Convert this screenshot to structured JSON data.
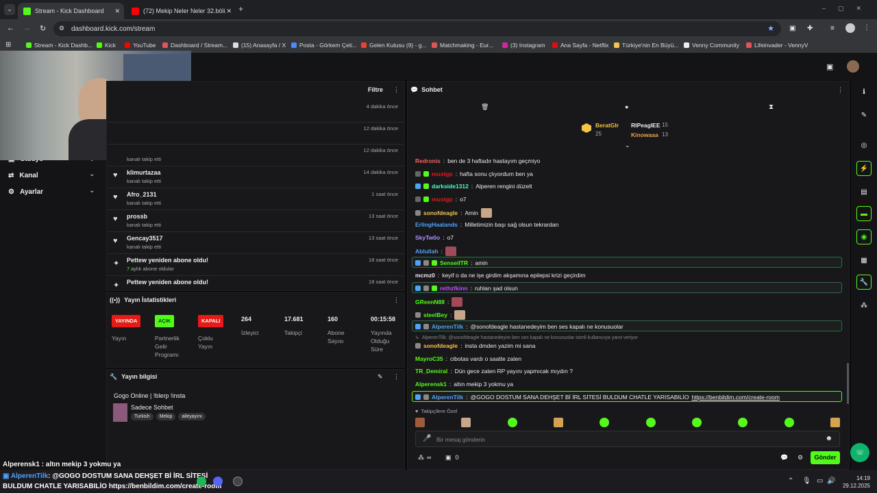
{
  "browser": {
    "tabs": [
      {
        "title": "Stream - Kick Dashboard",
        "favicon": "kick-icon"
      },
      {
        "title": "(72) Mekip Neler Neler 32.bölü",
        "favicon": "youtube-icon"
      }
    ],
    "url": "dashboard.kick.com/stream",
    "bookmarks": [
      "Stream - Kick Dashb...",
      "Kick",
      "YouTube",
      "Dashboard / Stream...",
      "(15) Anasayfa / X",
      "Posta - Görkem Çeti...",
      "Gelen Kutusu (9) - g...",
      "Matchmaking - Eur...",
      "(3) Instagram",
      "Ana Sayfa - Netflix",
      "Türkiye'nin En Büyü...",
      "Venny Community",
      "Lifeinvader - VennyV"
    ]
  },
  "sidebar": {
    "items": [
      {
        "label": "Stüdyo",
        "icon": "studio-icon"
      },
      {
        "label": "Kanal",
        "icon": "channel-icon"
      },
      {
        "label": "Ayarlar",
        "icon": "gear-icon"
      }
    ]
  },
  "activity": {
    "filter_label": "Filtre",
    "rows": [
      {
        "name": "",
        "sub": "",
        "time": "4 dakika önce"
      },
      {
        "name": "",
        "sub": "",
        "time": "12 dakika önce"
      },
      {
        "name": "",
        "sub": "kanalı takip etti",
        "time": "12 dakika önce"
      },
      {
        "name": "klimurtazaa",
        "sub": "kanalı takip etti",
        "time": "14 dakika önce"
      },
      {
        "name": "Afro_2131",
        "sub": "kanalı takip etti",
        "time": "1 saat önce"
      },
      {
        "name": "prossb",
        "sub": "kanalı takip etti",
        "time": "13 saat önce"
      },
      {
        "name": "Gencay3517",
        "sub": "kanalı takip etti",
        "time": "13 saat önce"
      },
      {
        "name": "Pettew yeniden abone oldu!",
        "sub_count": "7",
        "sub": "aylık abone oldular",
        "time": "18 saat önce"
      },
      {
        "name": "Pettew yeniden abone oldu!",
        "sub": "",
        "time": "18 saat önce"
      }
    ]
  },
  "stats": {
    "title": "Yayın İstatistikleri",
    "items": [
      {
        "badge": "YAYINDA",
        "badge_color": "#e91916",
        "label": "Yayın"
      },
      {
        "badge": "AÇIK",
        "badge_color": "#53fc18",
        "label": "Partnerlik Gelir Programı"
      },
      {
        "badge": "KAPALI",
        "badge_color": "#e91916",
        "label": "Çoklu Yayın"
      },
      {
        "value": "264",
        "label": "İzleyici"
      },
      {
        "value": "17.681",
        "label": "Takipçi"
      },
      {
        "value": "160",
        "label": "Abone Sayısı"
      },
      {
        "value": "00:15:58",
        "label": "Yayında Olduğu Süre"
      }
    ]
  },
  "stream_info": {
    "title": "Yayın bilgisi",
    "stream_title": "Gogo Online | !blerp !insta",
    "category": "Sadece Sohbet",
    "tags": [
      "Turkish",
      "Mekip",
      "aileyayını"
    ]
  },
  "chat": {
    "title": "Sohbet",
    "leaderboard": [
      {
        "name": "BeratGlr",
        "count": "25"
      },
      {
        "name": "RIPeagIEE",
        "count": "15"
      },
      {
        "name": "Kinowaaa",
        "count": "13"
      }
    ],
    "messages": [
      {
        "user": "Redronis",
        "color": "#ff5c5c",
        "text": "ben de 3 haftadır hastayım geçmiyo"
      },
      {
        "user": "mustgp",
        "color": "#e91916",
        "text": "hafta sonu çlıyordum ben ya"
      },
      {
        "user": "darkside1312",
        "color": "#53fcbf",
        "text": "Alperen rengini düzelt"
      },
      {
        "user": "mustgp",
        "color": "#e91916",
        "text": "o7"
      },
      {
        "user": "sonofdeagle",
        "color": "#f5c542",
        "text": "Amin"
      },
      {
        "user": "ErlingHaalands",
        "color": "#4da3ff",
        "text": "Milletimizin başı sağ olsun tekrardan"
      },
      {
        "user": "SkyTw0o",
        "color": "#b28dff",
        "text": "o7"
      },
      {
        "user": "Ablullah",
        "color": "#4da3ff",
        "text": ""
      },
      {
        "user": "SenseiITR",
        "color": "#53fc18",
        "text": "amin"
      },
      {
        "user": "mcmz0",
        "color": "#eeeeee",
        "text": "keyif o da ne işe girdim akşamına epilepsi krizi geçirdim"
      },
      {
        "user": "rethzfkinn",
        "color": "#c04dff",
        "text": "ruhları şad olsun"
      },
      {
        "user": "GReenN88",
        "color": "#53fc18",
        "text": ""
      },
      {
        "user": "steelBey",
        "color": "#53fc18",
        "text": ""
      },
      {
        "user": "AlperenTilk",
        "color": "#4da3ff",
        "text": "@sonofdeagle hastanedeyim ben ses kapalı ne konusuolar"
      },
      {
        "reply": "AlperenTilk: @sonofdeagle hastanedeyim ben ses kapalı ne konusuolar isimli kullanıcıya yanıt veriyor"
      },
      {
        "user": "sonofdeagle",
        "color": "#f5c542",
        "text": "insta dmden yazim mi sana"
      },
      {
        "user": "MayroC35",
        "color": "#53fc18",
        "text": "cibotas vardı o saatte zaten"
      },
      {
        "user": "TR_Demiral",
        "color": "#53fc18",
        "text": "Dün gece zaten RP yayını yapmıcak mıydın ?"
      },
      {
        "user": "Alperensk1",
        "color": "#53fc18",
        "text": "altın mekip 3 yokmu ya"
      },
      {
        "user": "AlperenTilk",
        "color": "#4da3ff",
        "text": "@GOGO DOSTUM SANA DEHŞET Bİ İRL SİTESİ BULDUM CHATLE YARISABILİO",
        "link": "https://benbildim.com/create-room"
      }
    ],
    "followers_only_label": "Takipçilere Özel",
    "input_placeholder": "Bir mesaj gönderin",
    "send_label": "Gönder",
    "points": "0"
  },
  "overlay": {
    "chat_1": "Alperensk1 : altın mekip 3 yokmu ya",
    "chat_2_user": "AlperenTilk",
    "chat_2_text": "@GOGO DOSTUM SANA DEHŞET Bİ İRL SİTESİ",
    "chat_3": "BULDUM CHATLE YARISABILİO https://benbildim.com/create-room"
  },
  "taskbar": {
    "time": "14:19",
    "date": "29.12.2025"
  }
}
